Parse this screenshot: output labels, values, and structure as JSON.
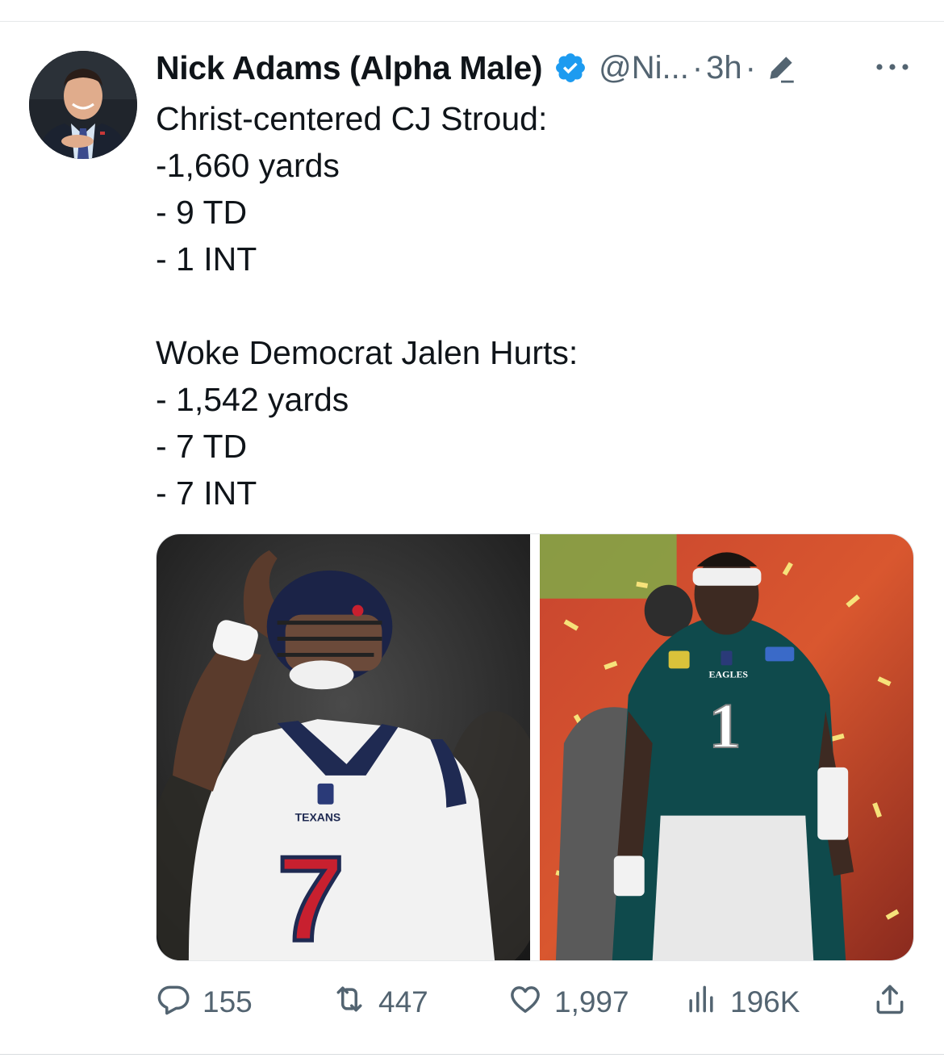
{
  "tweet": {
    "author": {
      "display_name": "Nick Adams (Alpha Male)",
      "handle": "@Ni...",
      "verified": true
    },
    "time": "3h",
    "separator": "·",
    "text_lines": [
      "Christ-centered CJ Stroud:",
      "-1,660 yards",
      "- 9 TD",
      "- 1 INT",
      "",
      "Woke Democrat Jalen Hurts:",
      "- 1,542 yards",
      "- 7 TD",
      "- 7 INT"
    ],
    "media": [
      {
        "jersey_text": "TEXANS",
        "jersey_number": "7"
      },
      {
        "jersey_text": "EAGLES",
        "jersey_number": "1"
      }
    ],
    "stats": {
      "replies": "155",
      "reposts": "447",
      "likes": "1,997",
      "views": "196K"
    }
  },
  "icons": {
    "verified": "verified-badge-icon",
    "edit": "edit-pencil-icon",
    "more": "more-dots-icon",
    "reply": "reply-icon",
    "repost": "repost-icon",
    "like": "heart-icon",
    "views": "views-bar-chart-icon",
    "share": "share-icon"
  },
  "colors": {
    "verified_blue": "#1d9bf0",
    "secondary_text": "#536471",
    "primary_text": "#0f1419"
  }
}
